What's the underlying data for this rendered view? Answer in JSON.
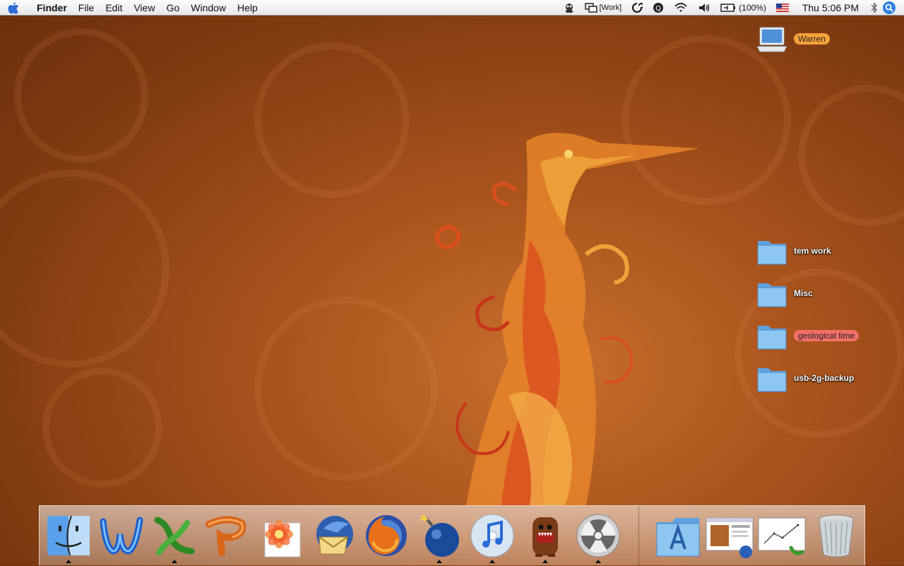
{
  "menubar": {
    "app_name": "Finder",
    "menus": [
      "File",
      "Edit",
      "View",
      "Go",
      "Window",
      "Help"
    ],
    "status": {
      "spaces_label": "[Work]",
      "battery": "(100%)",
      "clock": "Thu 5:06 PM"
    }
  },
  "desktop": {
    "items": [
      {
        "label": "Warren",
        "icon": "laptop-icon",
        "tag": "orange"
      },
      {
        "label": "tem work",
        "icon": "folder-icon"
      },
      {
        "label": "Misc",
        "icon": "folder-icon"
      },
      {
        "label": "geological time",
        "icon": "folder-icon",
        "tag": "red"
      },
      {
        "label": "usb-2g-backup",
        "icon": "folder-icon"
      }
    ]
  },
  "dock": {
    "apps": [
      {
        "name": "finder-icon",
        "running": true
      },
      {
        "name": "word-icon",
        "running": false
      },
      {
        "name": "excel-icon",
        "running": true
      },
      {
        "name": "powerpoint-icon",
        "running": false
      },
      {
        "name": "flower-app-icon",
        "running": false
      },
      {
        "name": "thunderbird-icon",
        "running": false
      },
      {
        "name": "firefox-icon",
        "running": false
      },
      {
        "name": "bomb-app-icon",
        "running": true
      },
      {
        "name": "itunes-icon",
        "running": true
      },
      {
        "name": "domo-icon",
        "running": true
      },
      {
        "name": "radiation-app-icon",
        "running": true
      }
    ],
    "docs": [
      "applications-folder-icon",
      "screenshot-document-icon",
      "chart-document-icon",
      "trash-icon"
    ]
  },
  "colors": {
    "accent": "#f7a13a",
    "tag_red": "#f2706a",
    "folder_blue": "#8ec6f2"
  }
}
